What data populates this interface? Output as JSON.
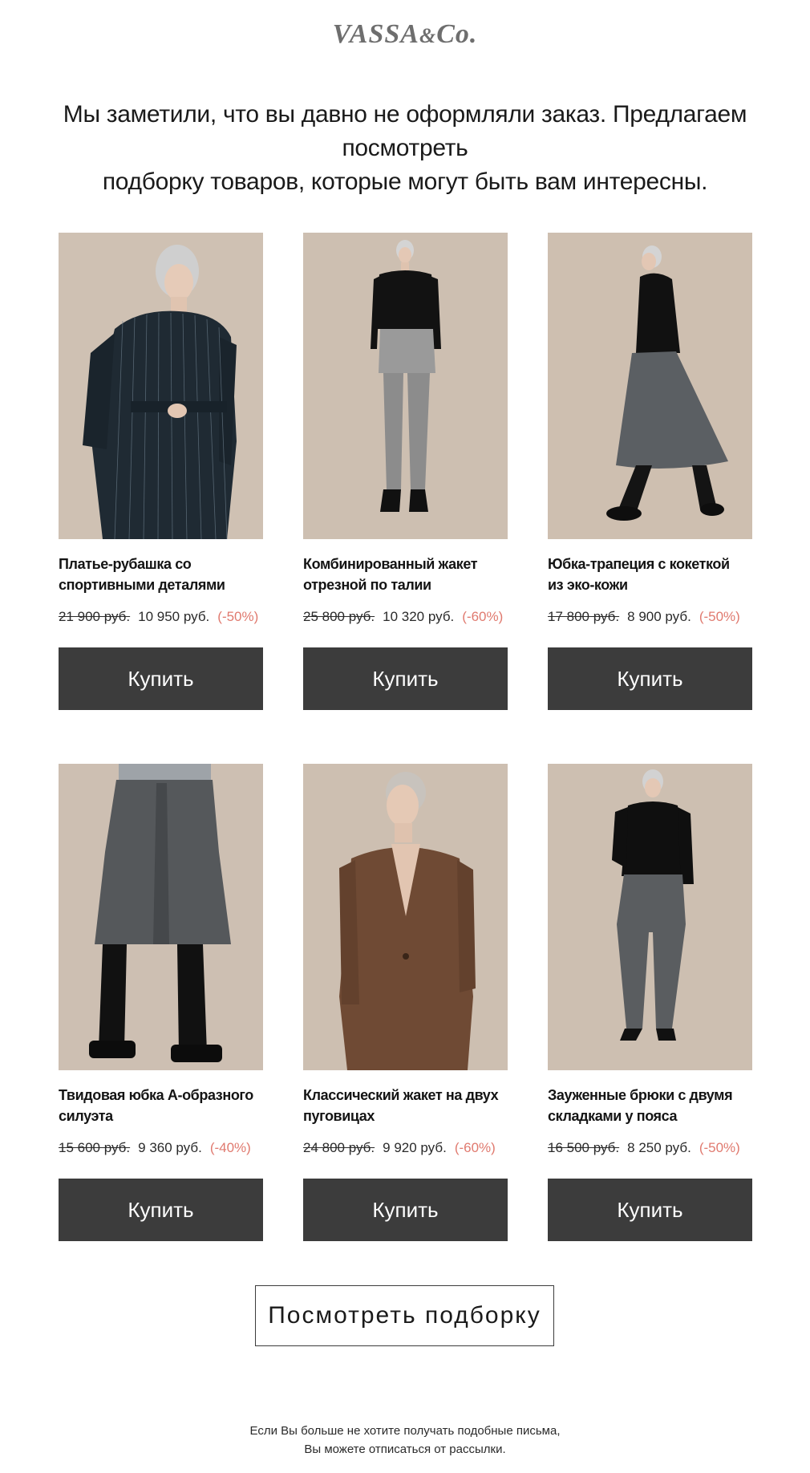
{
  "brand": {
    "logo_main": "VASSA",
    "logo_amp": "&",
    "logo_co": "Co."
  },
  "intro": {
    "line1": "Мы заметили, что вы давно не оформляли заказ. Предлагаем посмотреть",
    "line2": "подборку товаров, которые могут быть вам интересны."
  },
  "products": [
    {
      "name_line1": "Платье-рубашка со",
      "name_line2": "спортивными деталями",
      "old_price": "21 900 руб.",
      "new_price": "10 950 руб.",
      "discount": "(-50%)",
      "buy_label": "Купить",
      "image": "dress-shirt-photo"
    },
    {
      "name_line1": "Комбинированный жакет",
      "name_line2": "отрезной по талии",
      "old_price": "25 800 руб.",
      "new_price": "10 320 руб.",
      "discount": "(-60%)",
      "buy_label": "Купить",
      "image": "combined-jacket-photo"
    },
    {
      "name_line1": "Юбка-трапеция с кокеткой",
      "name_line2": "из эко-кожи",
      "old_price": "17 800 руб.",
      "new_price": "8 900 руб.",
      "discount": "(-50%)",
      "buy_label": "Купить",
      "image": "trapeze-skirt-photo"
    },
    {
      "name_line1": "Твидовая юбка А-образного",
      "name_line2": "силуэта",
      "old_price": "15 600 руб.",
      "new_price": "9 360 руб.",
      "discount": "(-40%)",
      "buy_label": "Купить",
      "image": "tweed-skirt-photo"
    },
    {
      "name_line1": "Классический жакет на двух",
      "name_line2": "пуговицах",
      "old_price": "24 800 руб.",
      "new_price": "9 920 руб.",
      "discount": "(-60%)",
      "buy_label": "Купить",
      "image": "classic-jacket-photo"
    },
    {
      "name_line1": "Зауженные брюки с двумя",
      "name_line2": "складками у пояса",
      "old_price": "16 500 руб.",
      "new_price": "8 250 руб.",
      "discount": "(-50%)",
      "buy_label": "Купить",
      "image": "tapered-trousers-photo"
    }
  ],
  "view_all": {
    "label": "Посмотреть подборку"
  },
  "footer": {
    "line1": "Если Вы больше не хотите получать подобные письма,",
    "line2": "Вы можете отписаться от рассылки."
  },
  "colors": {
    "button_bg": "#3c3c3c",
    "discount": "#e07a6f",
    "photo_bg": "#cdbfb2",
    "logo": "#6e6e6e"
  }
}
